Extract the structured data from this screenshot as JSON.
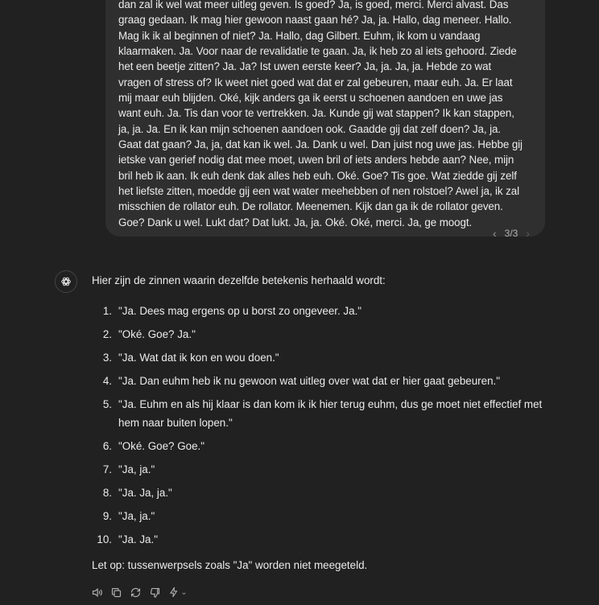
{
  "user_message": {
    "text": "dan zal ik wel wat meer uitleg geven. Is goed? Ja, is goed, merci. Merci alvast. Das graag gedaan. Ik mag hier gewoon naast gaan hé? Ja, ja. Hallo, dag meneer. Hallo. Mag ik ik al beginnen of niet? Ja. Hallo, dag Gilbert. Euhm, ik kom u vandaag klaarmaken. Ja. Voor naar de revalidatie te gaan. Ja, ik heb zo al iets gehoord. Ziede het een beetje zitten? Ja. Ja? Ist uwen eerste keer? Ja, ja. Ja, ja. Hebde zo wat vragen of stress of? Ik weet niet goed wat dat er zal gebeuren, maar euh. Ja. Er laat mij maar euh blijden. Oké, kijk anders ga ik eerst u schoenen aandoen en uwe jas want euh. Ja. Tis dan voor te vertrekken. Ja. Kunde gij wat stappen? Ik kan stappen, ja, ja. Ja. En ik kan mijn schoenen aandoen ook. Gaadde gij dat zelf doen? Ja, ja. Gaat dat gaan? Ja, ja, dat kan ik wel. Ja. Dank u wel. Dan juist nog uwe jas. Hebbe gij ietske van gerief nodig dat mee moet, uwen bril of iets anders hebde aan? Nee, mijn bril heb ik aan. Ik euh denk dak alles heb euh. Oké. Goe? Tis goe. Wat ziedde gij zelf het liefste zitten, moedde gij een wat water meehebben of nen rolstoel? Awel ja, ik zal misschien de rollator euh. De rollator. Meenemen. Kijk dan ga ik de rollator geven. Goe? Dank u wel. Lukt dat? Dat lukt. Ja, ja. Oké. Oké, merci. Ja, ge moogt."
  },
  "pager": {
    "label": "3/3"
  },
  "assistant": {
    "intro": "Hier zijn de zinnen waarin dezelfde betekenis herhaald wordt:",
    "items": [
      {
        "n": "1.",
        "text": "\"Ja. Dees mag ergens op u borst zo ongeveer. Ja.\""
      },
      {
        "n": "2.",
        "text": "\"Oké. Goe? Ja.\""
      },
      {
        "n": "3.",
        "text": "\"Ja. Wat dat ik kon en wou doen.\""
      },
      {
        "n": "4.",
        "text": "\"Ja. Dan euhm heb ik nu gewoon wat uitleg over wat dat er hier gaat gebeuren.\""
      },
      {
        "n": "5.",
        "text": "\"Ja. Euhm en als hij klaar is dan kom ik ik hier terug euhm, dus ge moet niet effectief met hem naar buiten lopen.\""
      },
      {
        "n": "6.",
        "text": "\"Oké. Goe? Goe.\""
      },
      {
        "n": "7.",
        "text": "\"Ja, ja.\""
      },
      {
        "n": "8.",
        "text": "\"Ja. Ja, ja.\""
      },
      {
        "n": "9.",
        "text": "\"Ja, ja.\""
      },
      {
        "n": "10.",
        "text": "\"Ja. Ja.\""
      }
    ],
    "note": "Let op: tussenwerpsels zoals \"Ja\" worden niet meegeteld."
  },
  "icons": {
    "avatar": "openai-logo-icon",
    "actions": [
      "read-aloud-icon",
      "copy-icon",
      "regenerate-icon",
      "thumbs-down-icon",
      "model-switch-icon"
    ]
  }
}
